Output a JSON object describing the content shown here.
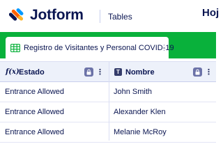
{
  "header": {
    "brand": "Jotform",
    "product": "Tables",
    "right_title": "Hoj"
  },
  "tabs": [
    {
      "label": "Registro de Visitantes y Personal COVID-19",
      "icon": "table-grid-icon"
    }
  ],
  "table": {
    "columns": [
      {
        "label": "Estado",
        "type_icon": "formula-icon"
      },
      {
        "label": "Nombre",
        "type_icon": "text-type-icon"
      }
    ],
    "rows": [
      {
        "estado": "Entrance Allowed",
        "nombre": "John Smith"
      },
      {
        "estado": "Entrance Allowed",
        "nombre": "Alexander Klen"
      },
      {
        "estado": "Entrance Allowed",
        "nombre": "Melanie McRoy"
      }
    ]
  },
  "colors": {
    "brand_navy": "#0a1551",
    "tab_bar_green": "#09b13b",
    "logo_orange": "#ff6100",
    "logo_blue": "#0099ff",
    "logo_yellow": "#ffb629"
  }
}
